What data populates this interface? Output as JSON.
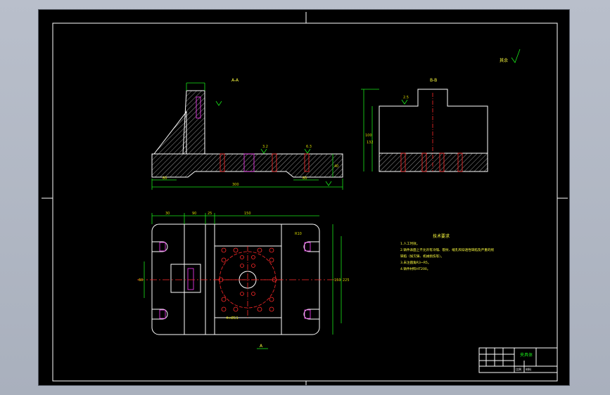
{
  "drawing": {
    "section_aa_label": "A-A",
    "section_bb_label": "B-B",
    "view_arrow_label": "A",
    "surface_other_label": "其余",
    "tech_title": "技术要求",
    "tech_notes": [
      "1.人工时效。",
      "2.铸件表面上不允许有冷隔、裂纹、缩孔和穿透性缺陷及严重的残",
      "  缺陷（如欠铸、机械损伤等）。",
      "3.未注圆角R3~R5。",
      "4.铸件材料HT200。"
    ]
  },
  "dims": {
    "aa_left_small": "80",
    "aa_total_length": "300",
    "aa_right_small": "80",
    "aa_height": "40",
    "aa_rough_1": "3.2",
    "aa_rough_2": "6.3",
    "bb_rough_1": "2.5",
    "bb_height_1": "100",
    "bb_height_2": "132",
    "top_a": "30",
    "top_b": "90",
    "top_c": "25",
    "top_d": "150",
    "top_right_height": "150",
    "top_inner_height": "225",
    "top_left_dim": "60",
    "radius_note": "R10",
    "hole_note": "4×Ø11"
  },
  "title_block": {
    "drawing_name": "夹具体",
    "scale_label": "比例",
    "material_label": "材料"
  }
}
